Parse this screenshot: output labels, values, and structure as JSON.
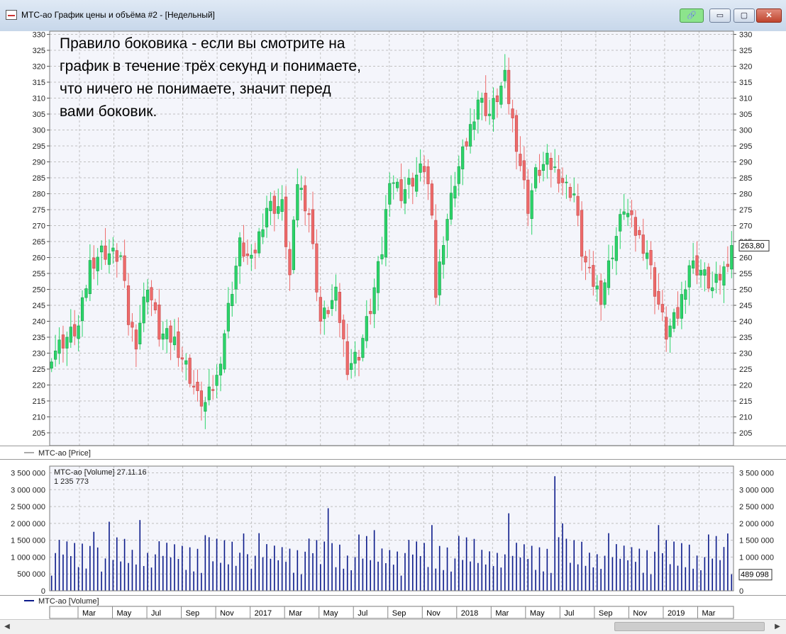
{
  "window": {
    "title": "МТС-ао График цены и объёма #2 - [Недельный]",
    "buttons": {
      "link": "🔗",
      "minimize": "▭",
      "maximize": "▢",
      "close": "✕"
    }
  },
  "annotation": [
    "Правило боковика - если вы смотрите на",
    "график в течение трёх секунд и понимаете,",
    "что ничего не понимаете, значит перед",
    "вами боковик."
  ],
  "colors": {
    "up": "#2bd56a",
    "down": "#ee6b6b",
    "volume": "#0b1a8a",
    "grid": "#c0c0c0"
  },
  "price_panel": {
    "legend": "МТС-ао [Price]",
    "last_value": "263,80",
    "yticks": [
      "330",
      "325",
      "320",
      "315",
      "310",
      "305",
      "300",
      "295",
      "290",
      "285",
      "280",
      "275",
      "270",
      "265",
      "260",
      "255",
      "250",
      "245",
      "240",
      "235",
      "230",
      "225",
      "220",
      "215",
      "210",
      "205"
    ]
  },
  "volume_panel": {
    "legend": "МТС-ао [Volume]",
    "info_line1": "МТС-ао [Volume] 27.11.16",
    "info_line2": "1 235 773",
    "last_value": "489 098",
    "yticks": [
      "3 500 000",
      "3 000 000",
      "2 500 000",
      "2 000 000",
      "1 500 000",
      "1 000 000",
      "500 000",
      "0"
    ]
  },
  "x_axis_labels": [
    "Mar",
    "May",
    "Jul",
    "Sep",
    "Nov",
    "2017",
    "Mar",
    "May",
    "Jul",
    "Sep",
    "Nov",
    "2018",
    "Mar",
    "May",
    "Jul",
    "Sep",
    "Nov",
    "2019",
    "Mar"
  ],
  "scrollbar": {
    "left": "◀",
    "right": "▶"
  },
  "chart_data": {
    "type": "candlestick",
    "interval": "weekly",
    "price_ylim": [
      201,
      331
    ],
    "volume_ylim": [
      0,
      3700000
    ],
    "anchors": [
      {
        "i": 0,
        "p": 230
      },
      {
        "i": 4,
        "p": 235
      },
      {
        "i": 7,
        "p": 238
      },
      {
        "i": 10,
        "p": 258
      },
      {
        "i": 13,
        "p": 262
      },
      {
        "i": 18,
        "p": 260
      },
      {
        "i": 20,
        "p": 240
      },
      {
        "i": 22,
        "p": 234
      },
      {
        "i": 25,
        "p": 252
      },
      {
        "i": 28,
        "p": 236
      },
      {
        "i": 32,
        "p": 234
      },
      {
        "i": 35,
        "p": 226
      },
      {
        "i": 38,
        "p": 216
      },
      {
        "i": 40,
        "p": 214
      },
      {
        "i": 43,
        "p": 222
      },
      {
        "i": 46,
        "p": 244
      },
      {
        "i": 49,
        "p": 264
      },
      {
        "i": 52,
        "p": 258
      },
      {
        "i": 56,
        "p": 276
      },
      {
        "i": 60,
        "p": 276
      },
      {
        "i": 62,
        "p": 254
      },
      {
        "i": 64,
        "p": 284
      },
      {
        "i": 67,
        "p": 274
      },
      {
        "i": 70,
        "p": 240
      },
      {
        "i": 72,
        "p": 244
      },
      {
        "i": 74,
        "p": 248
      },
      {
        "i": 77,
        "p": 226
      },
      {
        "i": 80,
        "p": 230
      },
      {
        "i": 83,
        "p": 244
      },
      {
        "i": 86,
        "p": 262
      },
      {
        "i": 88,
        "p": 286
      },
      {
        "i": 91,
        "p": 280
      },
      {
        "i": 94,
        "p": 284
      },
      {
        "i": 97,
        "p": 288
      },
      {
        "i": 99,
        "p": 276
      },
      {
        "i": 100,
        "p": 248
      },
      {
        "i": 102,
        "p": 266
      },
      {
        "i": 105,
        "p": 284
      },
      {
        "i": 108,
        "p": 296
      },
      {
        "i": 111,
        "p": 310
      },
      {
        "i": 114,
        "p": 305
      },
      {
        "i": 118,
        "p": 316
      },
      {
        "i": 121,
        "p": 296
      },
      {
        "i": 124,
        "p": 276
      },
      {
        "i": 126,
        "p": 286
      },
      {
        "i": 129,
        "p": 290
      },
      {
        "i": 132,
        "p": 286
      },
      {
        "i": 134,
        "p": 282
      },
      {
        "i": 136,
        "p": 280
      },
      {
        "i": 138,
        "p": 262
      },
      {
        "i": 140,
        "p": 254
      },
      {
        "i": 143,
        "p": 248
      },
      {
        "i": 146,
        "p": 262
      },
      {
        "i": 149,
        "p": 276
      },
      {
        "i": 152,
        "p": 268
      },
      {
        "i": 155,
        "p": 262
      },
      {
        "i": 157,
        "p": 250
      },
      {
        "i": 160,
        "p": 236
      },
      {
        "i": 163,
        "p": 242
      },
      {
        "i": 166,
        "p": 258
      },
      {
        "i": 169,
        "p": 256
      },
      {
        "i": 172,
        "p": 250
      },
      {
        "i": 175,
        "p": 256
      },
      {
        "i": 177,
        "p": 263.8
      }
    ],
    "volume_overrides": [
      {
        "i": 8,
        "v": 1400000
      },
      {
        "i": 11,
        "v": 1750000
      },
      {
        "i": 15,
        "v": 2050000
      },
      {
        "i": 23,
        "v": 2100000
      },
      {
        "i": 40,
        "v": 1650000
      },
      {
        "i": 50,
        "v": 1700000
      },
      {
        "i": 72,
        "v": 2450000
      },
      {
        "i": 84,
        "v": 1800000
      },
      {
        "i": 99,
        "v": 1950000
      },
      {
        "i": 119,
        "v": 2300000
      },
      {
        "i": 131,
        "v": 3400000
      },
      {
        "i": 133,
        "v": 2000000
      },
      {
        "i": 158,
        "v": 1950000
      },
      {
        "i": 176,
        "v": 1700000
      },
      {
        "i": 177,
        "v": 489098
      }
    ]
  }
}
